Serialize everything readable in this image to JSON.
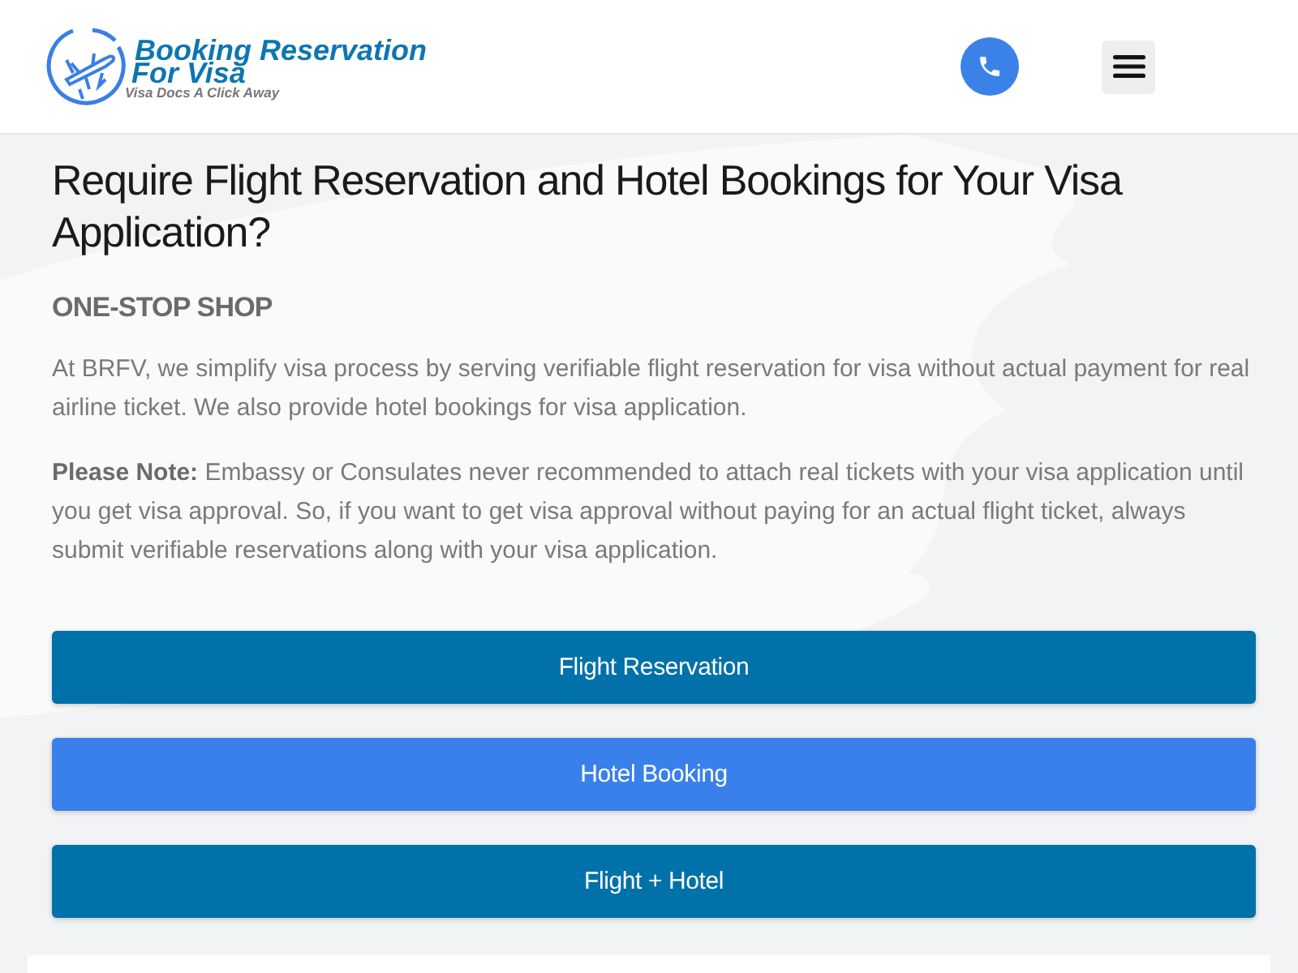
{
  "header": {
    "logo": {
      "title": "Booking Reservation",
      "subtitle": "For Visa",
      "tagline": "Visa Docs A Click Away"
    }
  },
  "hero": {
    "heading": "Require Flight Reservation and Hotel Bookings for Your Visa Application?",
    "subheading": "ONE-STOP SHOP",
    "paragraphs": [
      "At BRFV, we simplify visa process by serving verifiable flight reservation for visa without actual payment for real airline ticket. We also provide hotel bookings for visa application.",
      "**Please Note:** Embassy or Consulates never recommended to attach real tickets with your visa application until you get visa approval. So, if you want to get visa approval without paying for an actual flight ticket, always submit verifiable reservations along with your visa application."
    ]
  },
  "buttons": [
    {
      "label": "Flight Reservation",
      "color": "#0071a9"
    },
    {
      "label": "Hotel Booking",
      "color": "#3a80ea"
    },
    {
      "label": "Flight + Hotel",
      "color": "#0071a9"
    }
  ]
}
